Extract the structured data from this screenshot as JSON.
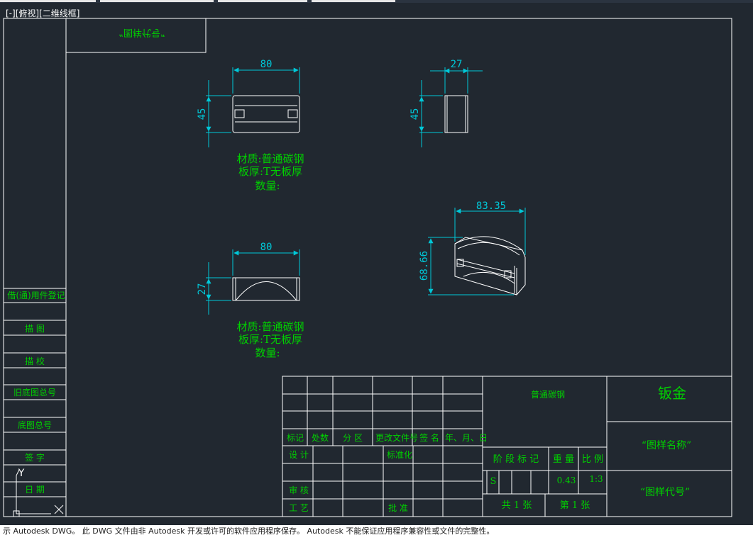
{
  "viewport": {
    "label": "[-][俯视][二维线框]"
  },
  "colors": {
    "background": "#212830",
    "frame": "#ffffff",
    "dimension": "#00c8d8",
    "annotation": "#00d000",
    "part": "#ffffff"
  },
  "title_block": {
    "drawing_no_mirrored": "“图样代号”",
    "material": "普通碳钢",
    "category": "钣金",
    "drawing_name": "“图样名称”",
    "drawing_code": "“图样代号”",
    "header": {
      "mark": "标记",
      "count": "处数",
      "zone": "分 区",
      "change_doc": "更改文件号",
      "sign": "签 名",
      "date": "年、月、日"
    },
    "roles": {
      "design": "设 计",
      "standard": "标准化",
      "review": "审 核",
      "process": "工 艺",
      "approve": "批 准"
    },
    "stage_mark": "阶 段 标 记",
    "weight_label": "重 量",
    "scale_label": "比 例",
    "stage_value": "S",
    "weight_value": "0.43",
    "scale_value": "1:3",
    "sheets_total": "共  1  张",
    "sheet_no": "第  1  张"
  },
  "side_block": {
    "items": [
      "借(通)用件登记",
      "描  图",
      "描  校",
      "旧底图总号",
      "底图总号",
      "签  字",
      "日  期"
    ]
  },
  "views": {
    "top_view": {
      "width_dim": "80",
      "height_dim": "45"
    },
    "side_view": {
      "width_dim": "27",
      "height_dim": "45"
    },
    "front_view": {
      "width_dim": "80",
      "height_dim": "27"
    },
    "iso_view": {
      "width_dim": "83.35",
      "height_dim": "68.66"
    },
    "note_1": {
      "material": "材质:普通碳钢",
      "thickness": "板厚:T无板厚",
      "quantity": "数量:"
    },
    "note_2": {
      "material": "材质:普通碳钢",
      "thickness": "板厚:T无板厚",
      "quantity": "数量:"
    }
  },
  "ucs": {
    "y_label": "Y"
  },
  "status_strip": {
    "text": "示 Autodesk DWG。 此 DWG 文件由非 Autodesk 开发或许可的软件应用程序保存。 Autodesk 不能保证应用程序兼容性或文件的完整性。"
  }
}
